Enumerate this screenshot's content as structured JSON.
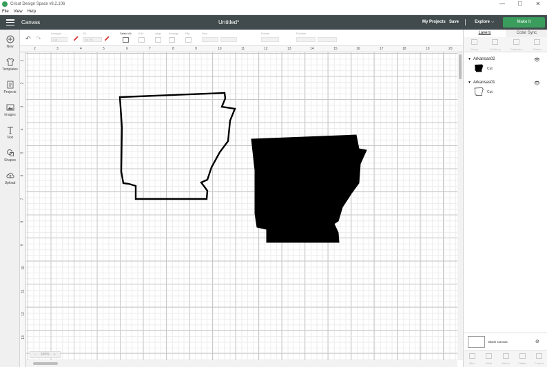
{
  "window": {
    "title": "Cricut Design Space v8.2.106",
    "controls": [
      "—",
      "☐",
      "✕"
    ]
  },
  "menu": [
    "File",
    "View",
    "Help"
  ],
  "header": {
    "section": "Canvas",
    "doc_title": "Untitled*",
    "my_projects": "My Projects",
    "save": "Save",
    "separator": "|",
    "explore": "Explore",
    "make_it": "Make It",
    "accent": "#3a9d5d",
    "bar_color": "#414a4c"
  },
  "toolbar": {
    "linetype_label": "Linetype",
    "linetype_value": "Cut",
    "fill_label": "Fill",
    "fill_value": "No Fill",
    "select_all": "Select All",
    "edit": "Edit",
    "align": "Align",
    "arrange": "Arrange",
    "flip": "Flip",
    "size": "Size",
    "rotate": "Rotate",
    "position": "Position"
  },
  "left_nav": [
    {
      "label": "New",
      "icon": "plus-icon"
    },
    {
      "label": "Templates",
      "icon": "shirt-icon"
    },
    {
      "label": "Projects",
      "icon": "projects-icon"
    },
    {
      "label": "Images",
      "icon": "images-icon"
    },
    {
      "label": "Text",
      "icon": "text-icon"
    },
    {
      "label": "Shapes",
      "icon": "shapes-icon"
    },
    {
      "label": "Upload",
      "icon": "upload-icon"
    }
  ],
  "ruler": {
    "top": [
      "2",
      "3",
      "4",
      "5",
      "6",
      "7",
      "8",
      "9",
      "10",
      "11",
      "12",
      "13",
      "14",
      "15",
      "16",
      "17",
      "18",
      "19",
      "20"
    ],
    "left": [
      "1",
      "2",
      "3",
      "4",
      "5",
      "6",
      "7",
      "8",
      "9",
      "10",
      "11",
      "12",
      "13"
    ]
  },
  "zoom": {
    "minus": "–",
    "value": "100%",
    "plus": "+"
  },
  "panel": {
    "tabs": [
      "Layers",
      "Color Sync"
    ],
    "top_tools": [
      "Group",
      "UnGroup",
      "Duplicate",
      "Delete"
    ],
    "layers": [
      {
        "name": "Arkansas02",
        "type": "Cut",
        "filled": true
      },
      {
        "name": "Arkansas01",
        "type": "Cut",
        "filled": false
      }
    ],
    "blank_canvas": "Blank Canvas",
    "bottom_tools": [
      "Slice",
      "Weld",
      "Attach",
      "Flatten",
      "Contour"
    ]
  }
}
